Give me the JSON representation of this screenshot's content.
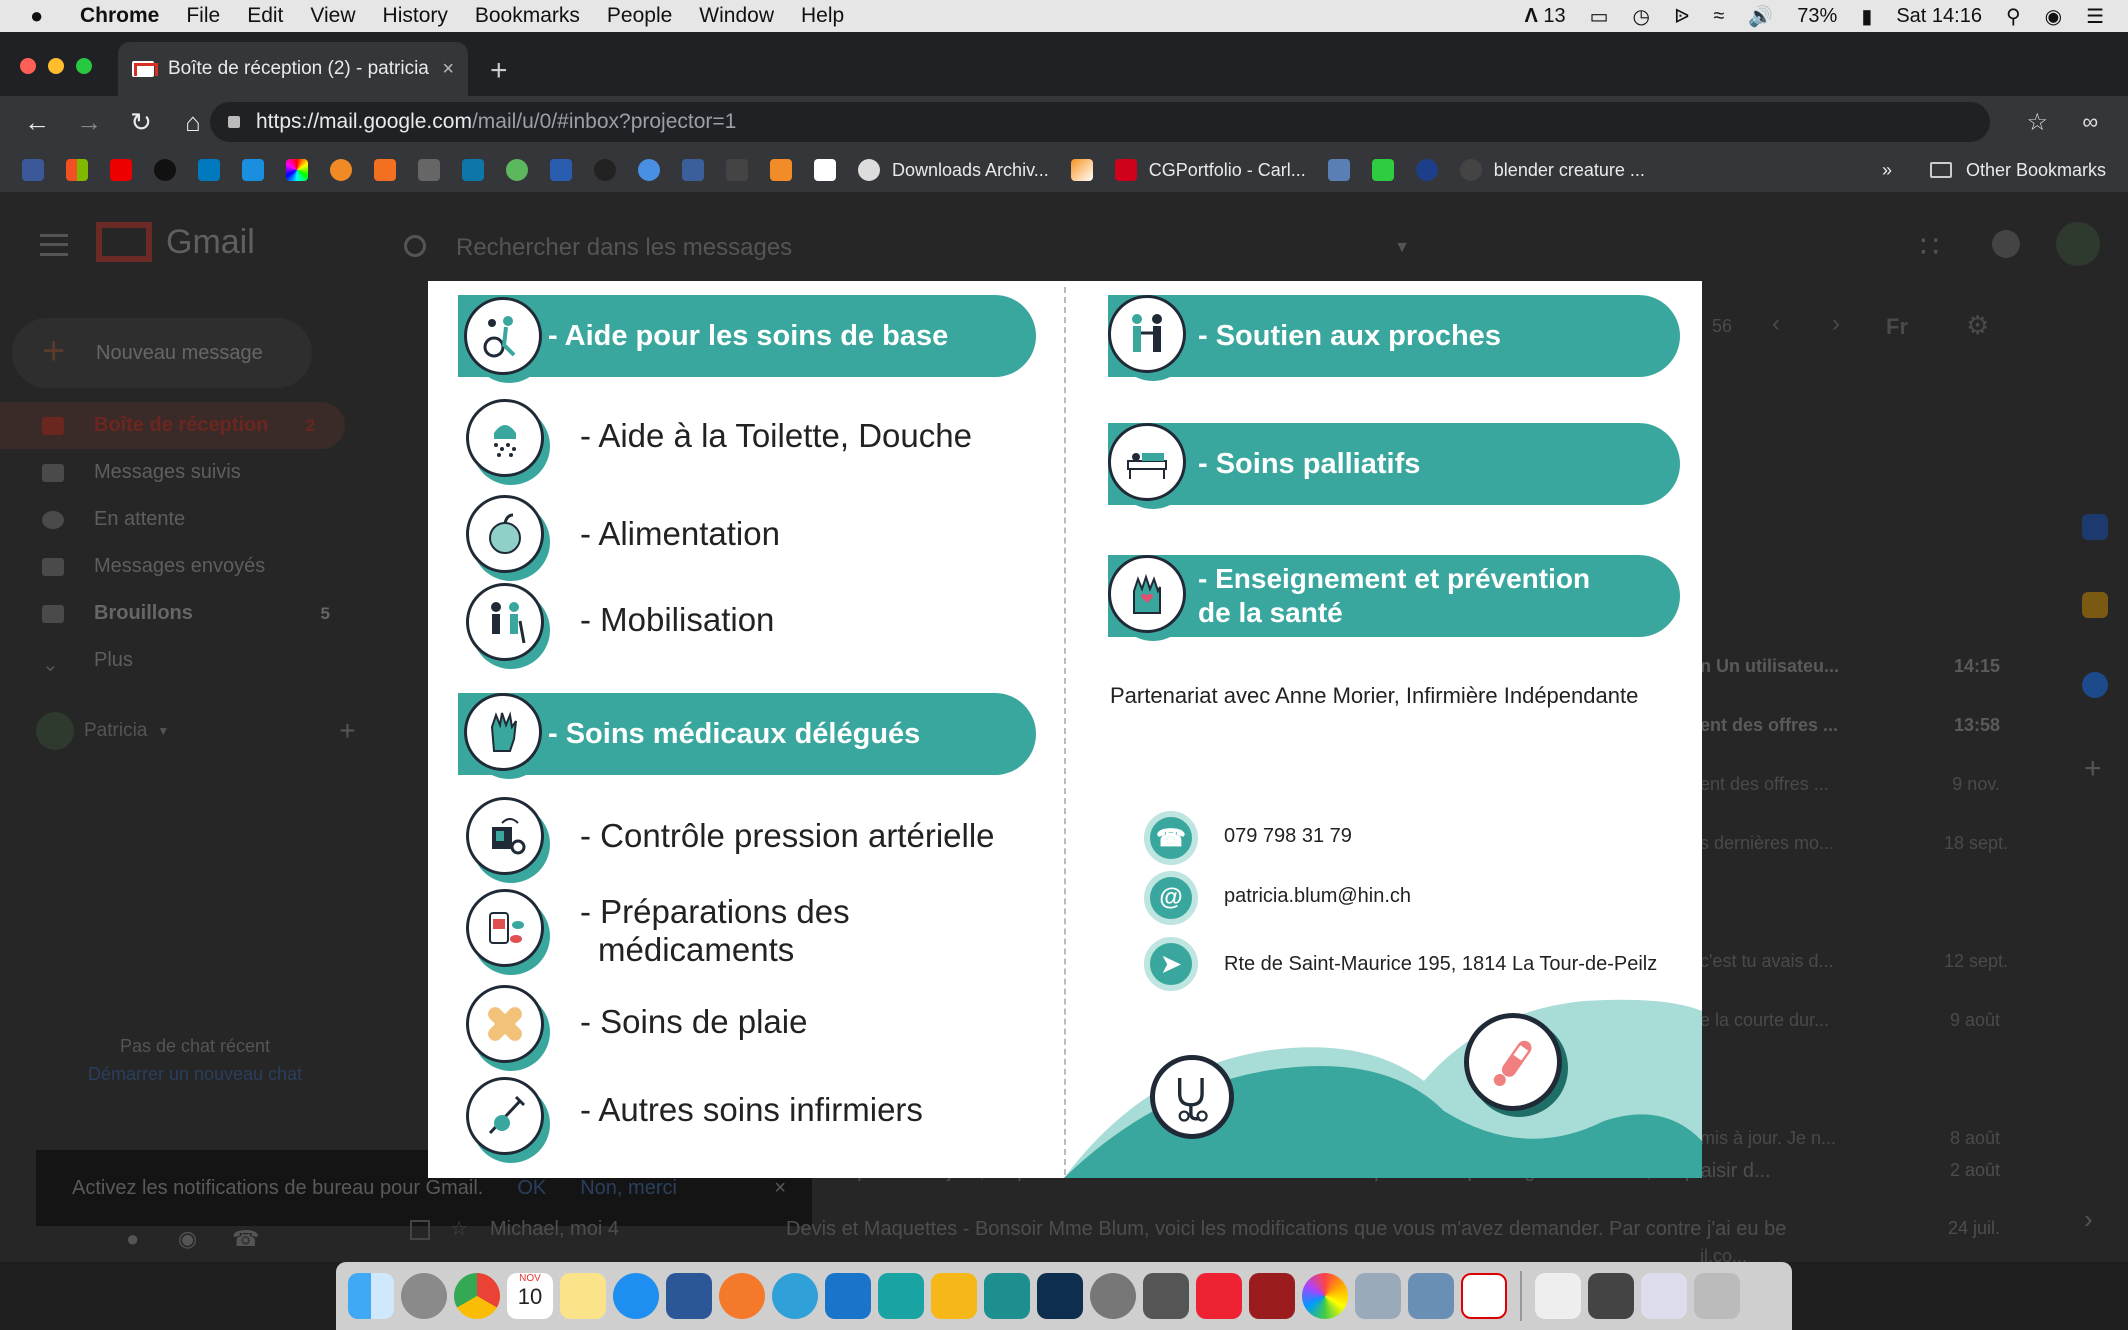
{
  "menubar": {
    "app": "Chrome",
    "items": [
      "File",
      "Edit",
      "View",
      "History",
      "Bookmarks",
      "People",
      "Window",
      "Help"
    ],
    "adobe_count": "13",
    "battery": "73%",
    "clock": "Sat 14:16"
  },
  "browser": {
    "tab_title": "Boîte de réception (2) - patricia",
    "url_host": "https://mail.google.com",
    "url_path": "/mail/u/0/#inbox?projector=1",
    "bookmarks": [
      "Downloads Archiv...",
      "CGPortfolio - Carl...",
      "blender creature ..."
    ],
    "bookmarks_overflow": "»",
    "other_bookmarks": "Other Bookmarks"
  },
  "gmail": {
    "logo_text": "Gmail",
    "search_placeholder": "Rechercher dans les messages",
    "compose": "Nouveau message",
    "nav": [
      {
        "label": "Boîte de réception",
        "count": "2"
      },
      {
        "label": "Messages suivis",
        "count": ""
      },
      {
        "label": "En attente",
        "count": ""
      },
      {
        "label": "Messages envoyés",
        "count": ""
      },
      {
        "label": "Brouillons",
        "count": "5"
      },
      {
        "label": "Plus",
        "count": ""
      }
    ],
    "user": "Patricia",
    "chat_empty": "Pas de chat récent",
    "chat_start": "Démarrer un nouveau chat",
    "notify_text": "Activez les notifications de bureau pour Gmail.",
    "notify_ok": "OK",
    "notify_no": "Non, merci",
    "pager": "56",
    "lang": "Fr",
    "mails": [
      {
        "snippet": "n Un utilisateu...",
        "date": "14:15"
      },
      {
        "snippet": "ent des offres ...",
        "date": "13:58"
      },
      {
        "snippet": "ent des offres ...",
        "date": "9 nov."
      },
      {
        "snippet": "s dernières mo...",
        "date": "18 sept."
      },
      {
        "snippet": "c'est tu avais d...",
        "date": "12 sept."
      },
      {
        "snippet": "e la courte dur...",
        "date": "9 août"
      },
      {
        "snippet": "mis à jour. Je n...",
        "date": "8 août"
      },
      {
        "snippet": "il.co...",
        "date": ""
      }
    ],
    "bottom_mails": [
      {
        "from": "",
        "subject": "il à Soinplus - Bonjour, Je prendrais contact avec vous la semaine prochaine pour agender un rdv, au plaisir d...",
        "date": "2 août"
      },
      {
        "from": "Michael, moi 4",
        "subject": "Devis et Maquettes - Bonsoir Mme Blum, voici les modifications que vous m'avez demander. Par contre j'ai eu be...",
        "date": "24 juil."
      }
    ]
  },
  "flyer": {
    "left": {
      "section1": "- Aide pour les soins de base",
      "items1": [
        "- Aide à la Toilette, Douche",
        "- Alimentation",
        "- Mobilisation"
      ],
      "section2": "- Soins médicaux délégués",
      "items2": [
        "- Contrôle pression artérielle",
        "- Préparations des",
        "médicaments",
        "- Soins de plaie",
        "- Autres soins infirmiers"
      ]
    },
    "right": {
      "pill1": "- Soutien aux proches",
      "pill2": "- Soins palliatifs",
      "pill3_line1": "- Enseignement et prévention",
      "pill3_line2": "de la santé",
      "partner": "Partenariat avec Anne Morier, Infirmière Indépendante",
      "phone": "079 798 31 79",
      "email": "patricia.blum@hin.ch",
      "address": "Rte de Saint-Maurice 195, 1814 La Tour-de-Peilz"
    },
    "colors": {
      "teal": "#3aa79e",
      "light_teal": "#a8dcd6",
      "navy": "#1f2a36"
    }
  },
  "dock": {
    "calendar_month": "NOV",
    "calendar_day": "10"
  }
}
